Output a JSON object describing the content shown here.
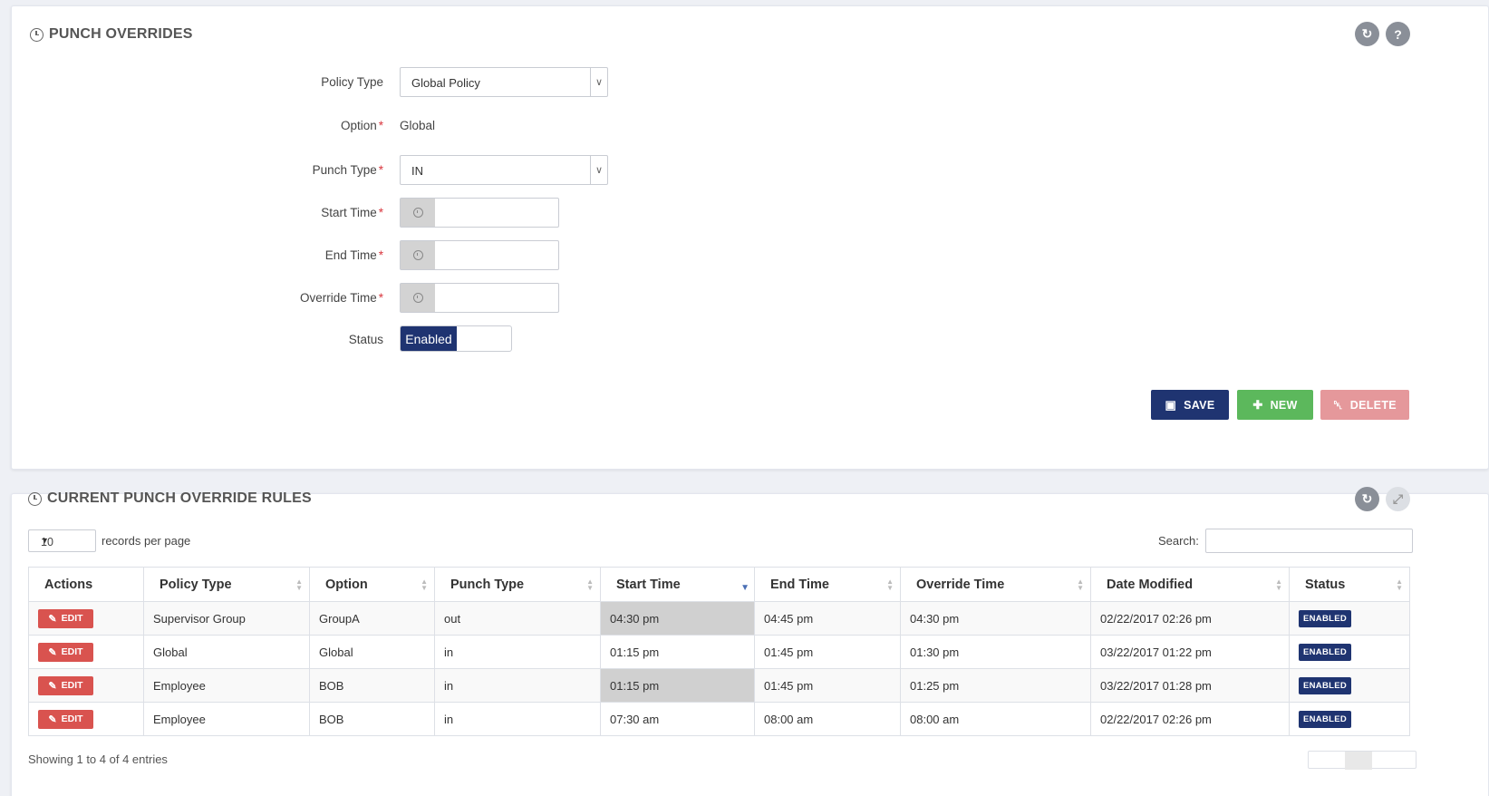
{
  "form_panel": {
    "title": "PUNCH OVERRIDES",
    "fields": {
      "policy_type": {
        "label": "Policy Type",
        "value": "Global Policy"
      },
      "option": {
        "label": "Option",
        "value": "Global"
      },
      "punch_type": {
        "label": "Punch Type",
        "value": "IN"
      },
      "start_time": {
        "label": "Start Time",
        "value": ""
      },
      "end_time": {
        "label": "End Time",
        "value": ""
      },
      "override_time": {
        "label": "Override Time",
        "value": ""
      },
      "status": {
        "label": "Status",
        "value": "Enabled"
      }
    },
    "required_mark": "*",
    "buttons": {
      "save": "SAVE",
      "new": "NEW",
      "delete": "DELETE"
    }
  },
  "rules_panel": {
    "title": "CURRENT PUNCH OVERRIDE RULES",
    "page_size": "10",
    "records_label": "records per page",
    "search_label": "Search:",
    "columns": [
      "Actions",
      "Policy Type",
      "Option",
      "Punch Type",
      "Start Time",
      "End Time",
      "Override Time",
      "Date Modified",
      "Status"
    ],
    "sorted_column": "Start Time",
    "edit_label": "EDIT",
    "rows": [
      {
        "policy_type": "Supervisor Group",
        "option": "GroupA",
        "punch_type": "out",
        "start_time": "04:30 pm",
        "end_time": "04:45 pm",
        "override_time": "04:30 pm",
        "date_modified": "02/22/2017 02:26 pm",
        "status": "ENABLED"
      },
      {
        "policy_type": "Global",
        "option": "Global",
        "punch_type": "in",
        "start_time": "01:15 pm",
        "end_time": "01:45 pm",
        "override_time": "01:30 pm",
        "date_modified": "03/22/2017 01:22 pm",
        "status": "ENABLED"
      },
      {
        "policy_type": "Employee",
        "option": "BOB",
        "punch_type": "in",
        "start_time": "01:15 pm",
        "end_time": "01:45 pm",
        "override_time": "01:25 pm",
        "date_modified": "03/22/2017 01:28 pm",
        "status": "ENABLED"
      },
      {
        "policy_type": "Employee",
        "option": "BOB",
        "punch_type": "in",
        "start_time": "07:30 am",
        "end_time": "08:00 am",
        "override_time": "08:00 am",
        "date_modified": "02/22/2017 02:26 pm",
        "status": "ENABLED"
      }
    ],
    "footer_info": "Showing 1 to 4 of 4 entries"
  },
  "colors": {
    "primary": "#1f3471",
    "success": "#5cb85c",
    "danger": "#d9534f",
    "danger_disabled": "#e5989b"
  },
  "icons": {
    "refresh": "refresh-icon",
    "help": "help-icon",
    "expand": "expand-icon",
    "clock": "clock-icon"
  }
}
